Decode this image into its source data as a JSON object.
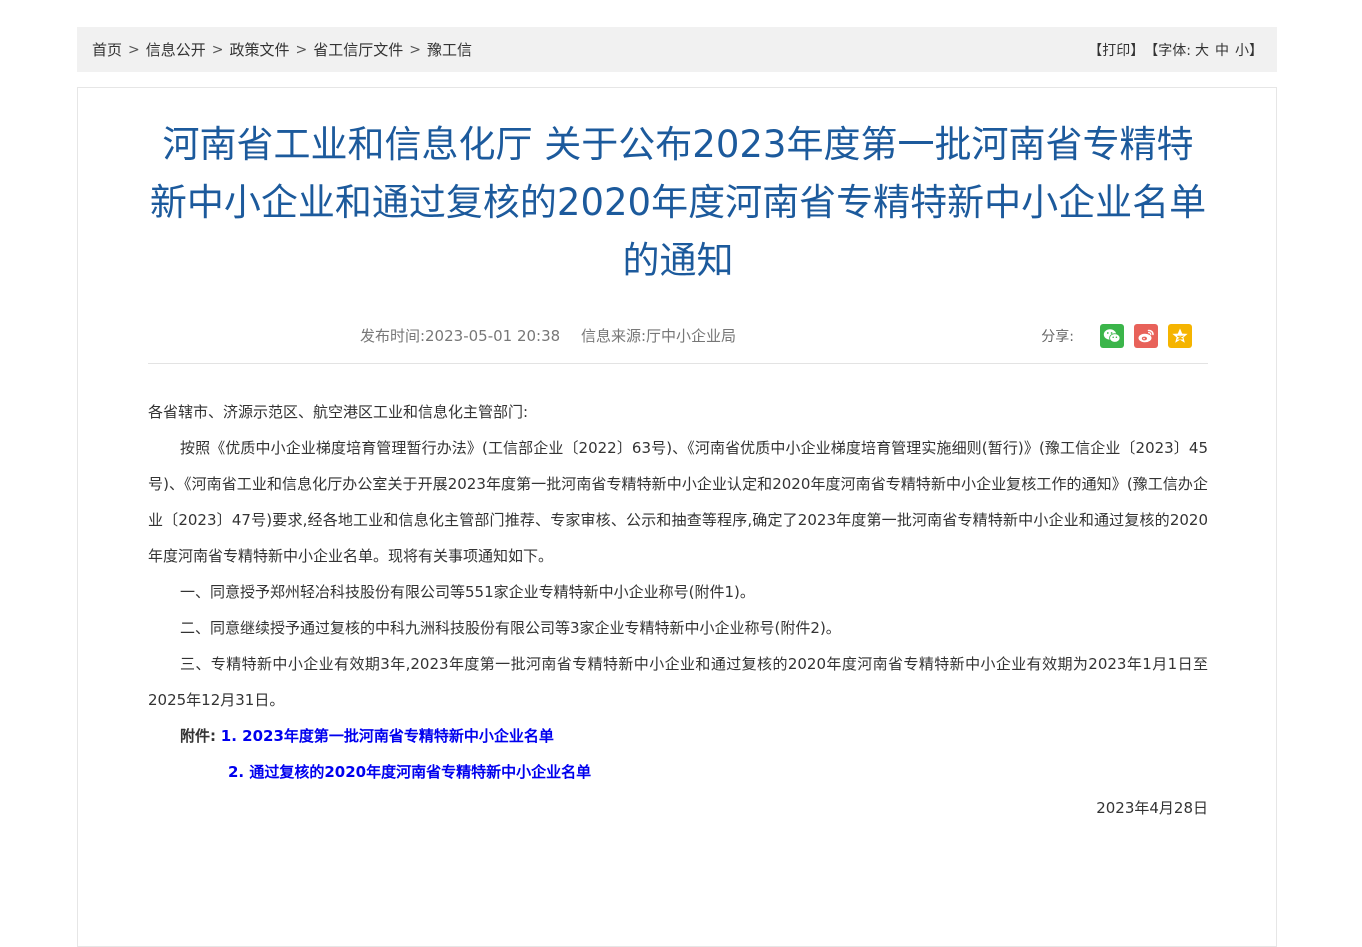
{
  "breadcrumb": {
    "items": [
      "首页",
      "信息公开",
      "政策文件",
      "省工信厅文件",
      "豫工信"
    ],
    "separator": ">"
  },
  "tools": {
    "print": "【打印】",
    "font_open": "【字体:",
    "sizes": [
      "大",
      "中",
      "小"
    ],
    "font_close": "】"
  },
  "article": {
    "title": "河南省工业和信息化厅 关于公布2023年度第一批河南省专精特新中小企业和通过复核的2020年度河南省专精特新中小企业名单的通知",
    "publish_label": "发布时间:",
    "publish_time": "2023-05-01 20:38",
    "source_label": "信息来源:",
    "source": "厅中小企业局",
    "share_label": "分享:",
    "share_icons": [
      "wechat-icon",
      "weibo-icon",
      "qzone-icon"
    ],
    "salutation": "各省辖市、济源示范区、航空港区工业和信息化主管部门:",
    "paragraphs": [
      "按照《优质中小企业梯度培育管理暂行办法》(工信部企业〔2022〕63号)、《河南省优质中小企业梯度培育管理实施细则(暂行)》(豫工信企业〔2023〕45号)、《河南省工业和信息化厅办公室关于开展2023年度第一批河南省专精特新中小企业认定和2020年度河南省专精特新中小企业复核工作的通知》(豫工信办企业〔2023〕47号)要求,经各地工业和信息化主管部门推荐、专家审核、公示和抽查等程序,确定了2023年度第一批河南省专精特新中小企业和通过复核的2020年度河南省专精特新中小企业名单。现将有关事项通知如下。",
      "一、同意授予郑州轻冶科技股份有限公司等551家企业专精特新中小企业称号(附件1)。",
      "二、同意继续授予通过复核的中科九洲科技股份有限公司等3家企业专精特新中小企业称号(附件2)。",
      "三、专精特新中小企业有效期3年,2023年度第一批河南省专精特新中小企业和通过复核的2020年度河南省专精特新中小企业有效期为2023年1月1日至2025年12月31日。"
    ],
    "attachment_label": "附件:",
    "attachments": [
      "1. 2023年度第一批河南省专精特新中小企业名单",
      "2. 通过复核的2020年度河南省专精特新中小企业名单"
    ],
    "date": "2023年4月28日"
  },
  "colors": {
    "title": "#1c5a9c",
    "link": "#0000ee",
    "breadcrumb_bg": "#f1f1f1",
    "wechat": "#3bb54a",
    "weibo": "#e8625a",
    "qzone": "#f5b400"
  }
}
